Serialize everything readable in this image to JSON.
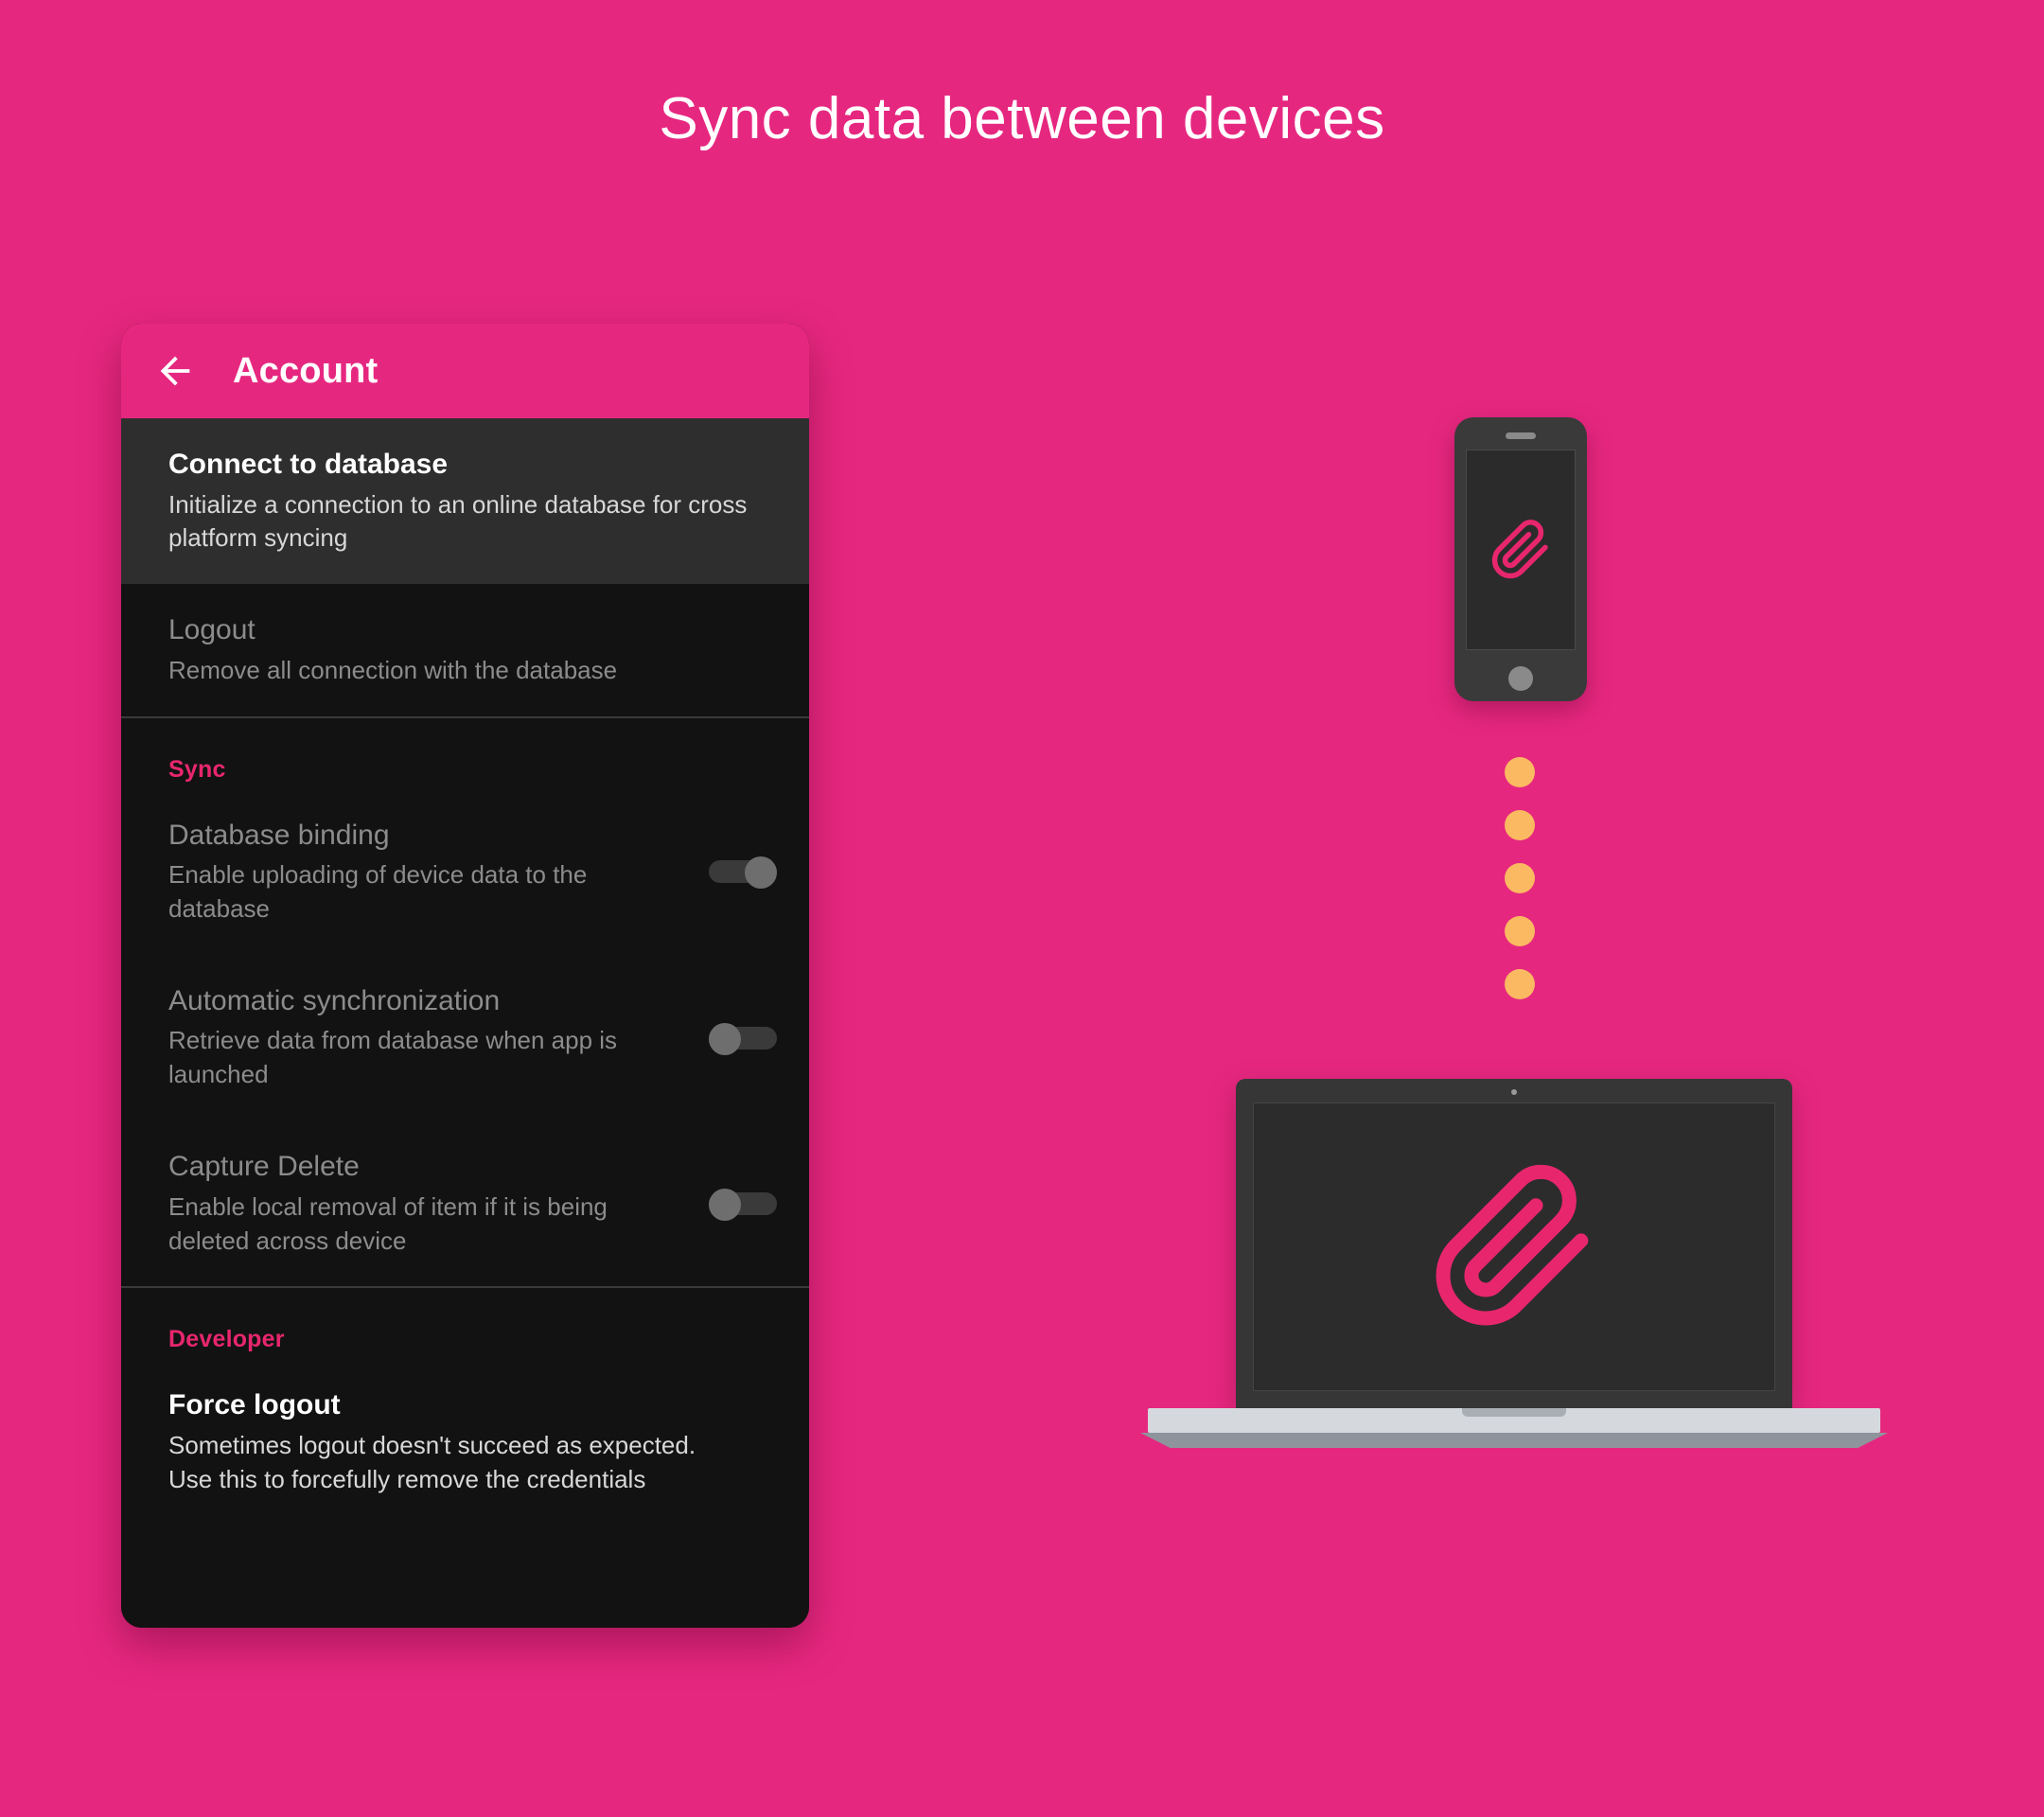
{
  "page": {
    "title": "Sync data between devices",
    "background_color": "#E62780",
    "accent_color": "#E8266E",
    "dot_color": "#FBBA61"
  },
  "app_bar": {
    "back_icon": "arrow-left-icon",
    "title": "Account"
  },
  "settings": {
    "rows": [
      {
        "id": "connect-to-database",
        "title": "Connect to database",
        "subtitle": "Initialize a connection to an online database for cross platform syncing",
        "state": "enabled",
        "highlighted": true
      },
      {
        "id": "logout",
        "title": "Logout",
        "subtitle": "Remove all connection with the database",
        "state": "disabled",
        "highlighted": false
      }
    ],
    "sections": [
      {
        "id": "sync",
        "header": "Sync",
        "items": [
          {
            "id": "database-binding",
            "title": "Database binding",
            "subtitle": "Enable uploading of device data to the database",
            "toggle": "on",
            "state": "disabled"
          },
          {
            "id": "automatic-synchronization",
            "title": "Automatic synchronization",
            "subtitle": "Retrieve data from database when app is launched",
            "toggle": "off",
            "state": "disabled"
          },
          {
            "id": "capture-delete",
            "title": "Capture Delete",
            "subtitle": "Enable local removal of item if it is being deleted across device",
            "toggle": "off",
            "state": "disabled"
          }
        ]
      },
      {
        "id": "developer",
        "header": "Developer",
        "items": [
          {
            "id": "force-logout",
            "title": "Force logout",
            "subtitle": "Sometimes logout doesn't succeed as expected. Use this to forcefully remove the credentials",
            "state": "enabled"
          }
        ]
      }
    ]
  },
  "illustration": {
    "phone": {
      "name": "smartphone",
      "screen_icon": "paperclip-icon"
    },
    "laptop": {
      "name": "laptop",
      "screen_icon": "paperclip-icon"
    },
    "sync_dots_count": 5
  }
}
